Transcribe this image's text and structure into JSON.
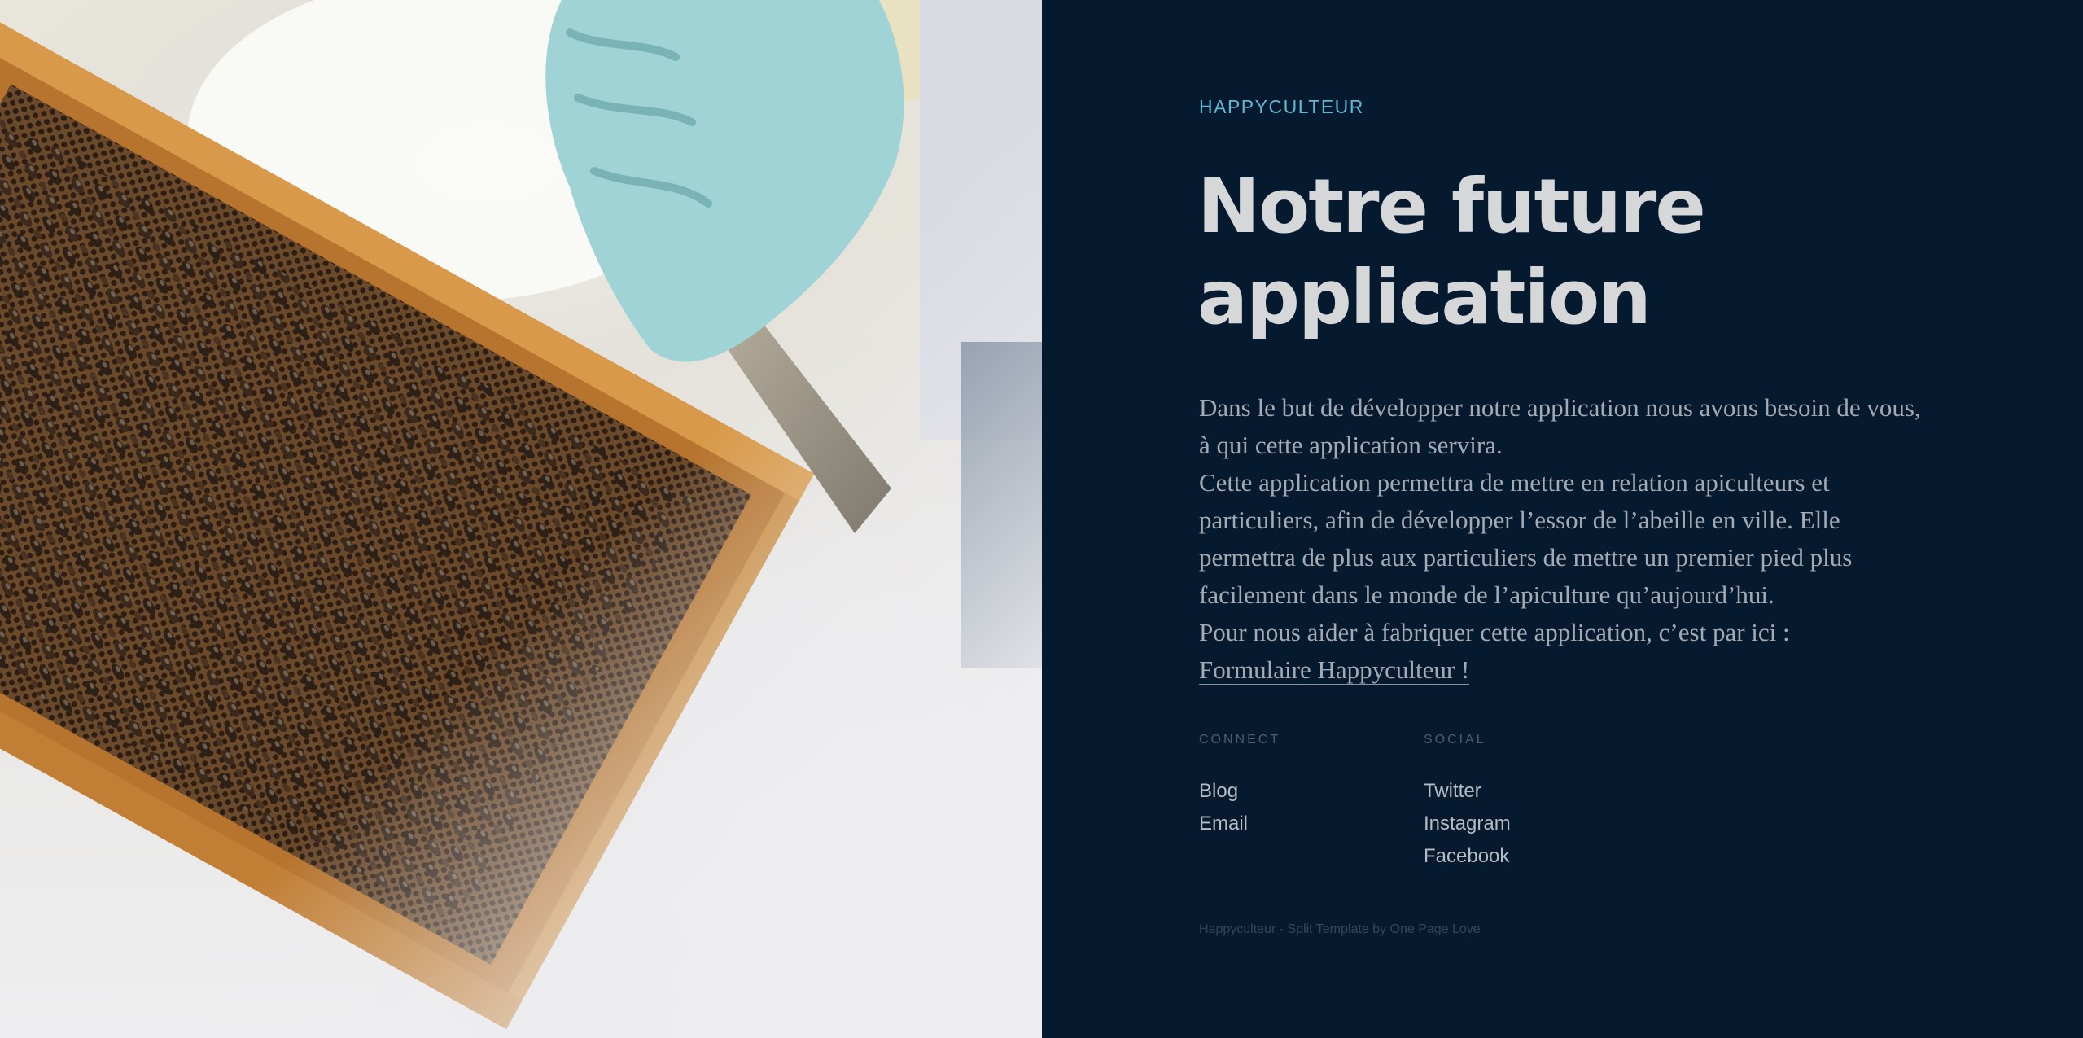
{
  "brand": {
    "name": "HAPPYCULTEUR"
  },
  "hero": {
    "title_line1": "Notre future",
    "title_line2": "application",
    "paragraph1": "Dans le but de développer notre application nous avons besoin de vous, à qui cette application servira.",
    "paragraph2": "Cette application permettra de mettre en relation apiculteurs et particuliers, afin de développer l’essor de l’abeille en ville. Elle permettra de plus aux particuliers de mettre un premier pied plus facilement dans le monde de l’apiculture qu’aujourd’hui.",
    "paragraph3_text": "Pour nous aider à fabriquer cette application, c’est par ici :",
    "form_link": "Formulaire Happyculteur !"
  },
  "connect": {
    "heading": "CONNECT",
    "items": [
      {
        "label": "Blog"
      },
      {
        "label": "Email"
      }
    ]
  },
  "social": {
    "heading": "SOCIAL",
    "items": [
      {
        "label": "Twitter"
      },
      {
        "label": "Instagram"
      },
      {
        "label": "Facebook"
      }
    ]
  },
  "footer": {
    "text": "Happyculteur - Split Template by",
    "link": "One Page Love"
  },
  "colors": {
    "panel_bg": "#061a2f",
    "accent": "#5fb7d3",
    "heading": "#d6d7d9",
    "body_text": "#a3aab3"
  },
  "image": {
    "icon": "beehive-frame-photo"
  }
}
